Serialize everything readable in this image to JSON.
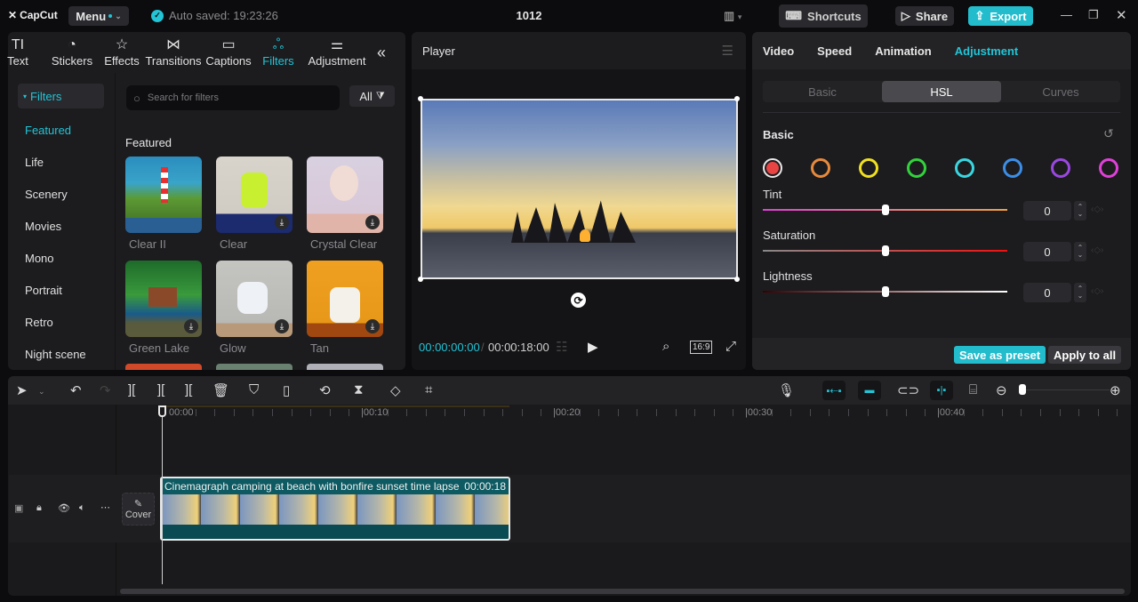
{
  "app": {
    "name": "CapCut",
    "title": "1012",
    "autosave": "Auto saved: 19:23:26"
  },
  "topbar": {
    "menu_label": "Menu",
    "shortcuts_label": "Shortcuts",
    "share_label": "Share",
    "export_label": "Export",
    "accent": "#22c4d6"
  },
  "tool_tabs": [
    {
      "label": "Text",
      "icon": "text-icon"
    },
    {
      "label": "Stickers",
      "icon": "sticker-icon"
    },
    {
      "label": "Effects",
      "icon": "effects-star-icon"
    },
    {
      "label": "Transitions",
      "icon": "transitions-bowtie-icon"
    },
    {
      "label": "Captions",
      "icon": "captions-icon"
    },
    {
      "label": "Filters",
      "icon": "filters-icon",
      "active": true
    },
    {
      "label": "Adjustment",
      "icon": "adjustment-sliders-icon"
    }
  ],
  "library": {
    "section_header": "Filters",
    "categories": [
      "Featured",
      "Life",
      "Scenery",
      "Movies",
      "Mono",
      "Portrait",
      "Retro",
      "Night scene"
    ],
    "active_category": "Featured",
    "search_placeholder": "Search for filters",
    "all_label": "All",
    "group_title": "Featured",
    "items": [
      {
        "label": "Clear II",
        "downloaded": true
      },
      {
        "label": "Clear",
        "downloaded": false
      },
      {
        "label": "Crystal Clear",
        "downloaded": false
      },
      {
        "label": "Green Lake",
        "downloaded": false
      },
      {
        "label": "Glow",
        "downloaded": false
      },
      {
        "label": "Tan",
        "downloaded": false
      }
    ]
  },
  "player": {
    "title": "Player",
    "current_time": "00:00:00:00",
    "total_time": "00:00:18:00",
    "ratio": "16:9"
  },
  "inspector": {
    "tabs": [
      "Video",
      "Speed",
      "Animation",
      "Adjustment"
    ],
    "active_tab": "Adjustment",
    "subtabs": [
      "Basic",
      "HSL",
      "Curves"
    ],
    "active_subtab": "HSL",
    "section_title": "Basic",
    "colors": [
      "#e84444",
      "#e88a3c",
      "#f0e020",
      "#32d23c",
      "#3ad6e0",
      "#3c8ee6",
      "#9a48e0",
      "#e040d8"
    ],
    "selected_color": 0,
    "sliders": [
      {
        "label": "Tint",
        "value": "0",
        "position": 0.5
      },
      {
        "label": "Saturation",
        "value": "0",
        "position": 0.5
      },
      {
        "label": "Lightness",
        "value": "0",
        "position": 0.5
      }
    ],
    "save_preset_label": "Save as preset",
    "apply_all_label": "Apply to all"
  },
  "timeline": {
    "ruler": [
      "00:00",
      "00:10",
      "00:20",
      "00:30",
      "00:40"
    ],
    "clip_title": "Cinemagraph camping at beach with bonfire sunset time lapse",
    "clip_duration": "00:00:18",
    "cover_label": "Cover"
  }
}
